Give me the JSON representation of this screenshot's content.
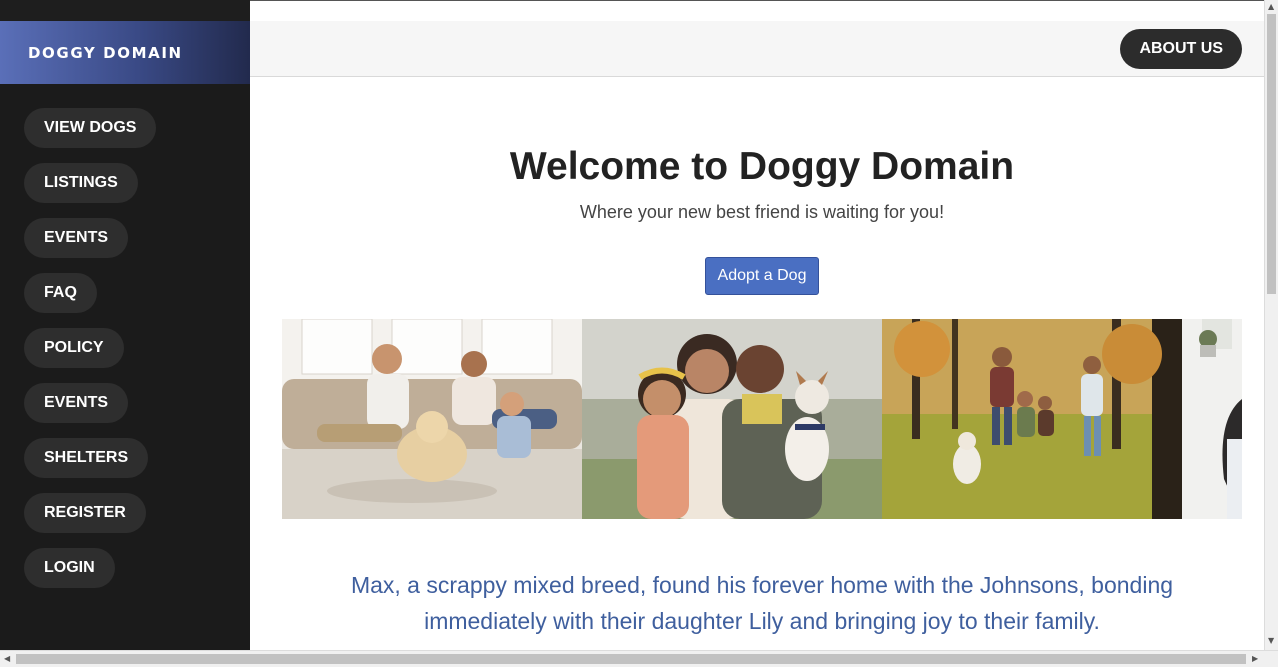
{
  "brand": {
    "name": "DOGGY DOMAIN"
  },
  "sidebar": {
    "items": [
      {
        "label": "VIEW DOGS"
      },
      {
        "label": "LISTINGS"
      },
      {
        "label": "EVENTS"
      },
      {
        "label": "FAQ"
      },
      {
        "label": "POLICY"
      },
      {
        "label": "EVENTS"
      },
      {
        "label": "SHELTERS"
      },
      {
        "label": "REGISTER"
      },
      {
        "label": "LOGIN"
      }
    ]
  },
  "header": {
    "about_label": "ABOUT US"
  },
  "hero": {
    "title": "Welcome to Doggy Domain",
    "subtitle": "Where your new best friend is waiting for you!",
    "cta_label": "Adopt a Dog"
  },
  "story": {
    "text": "Max, a scrappy mixed breed, found his forever home with the Johnsons, bonding immediately with their daughter Lily and bringing joy to their family."
  },
  "colors": {
    "sidebar_bg": "#1b1b1b",
    "brand_gradient_start": "#5a6fb8",
    "cta_blue": "#4a6fc2",
    "story_blue": "#3f5f9e"
  }
}
